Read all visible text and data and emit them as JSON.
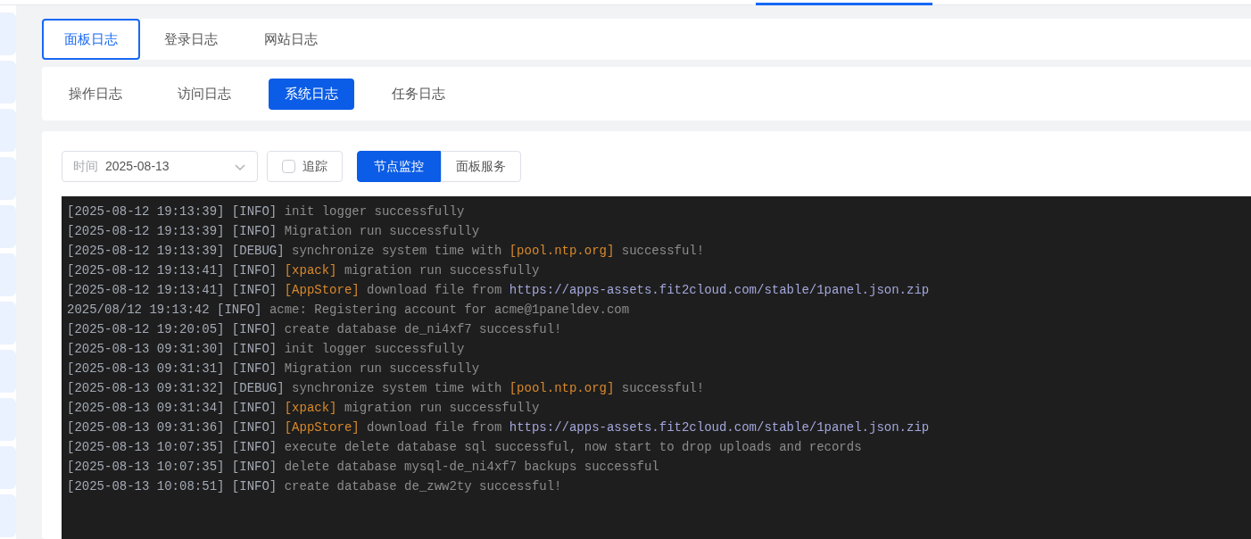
{
  "log_tabs": [
    {
      "label": "面板日志",
      "selected": true
    },
    {
      "label": "登录日志",
      "selected": false
    },
    {
      "label": "网站日志",
      "selected": false
    }
  ],
  "sub_tabs": [
    {
      "label": "操作日志",
      "selected": false
    },
    {
      "label": "访问日志",
      "selected": false
    },
    {
      "label": "系统日志",
      "selected": true
    },
    {
      "label": "任务日志",
      "selected": false
    }
  ],
  "filters": {
    "date_label": "时间",
    "date_value": "2025-08-13",
    "follow": {
      "label": "追踪",
      "checked": false
    }
  },
  "source_buttons": [
    {
      "label": "节点监控",
      "selected": true
    },
    {
      "label": "面板服务",
      "selected": false
    }
  ],
  "log_lines": [
    {
      "segments": [
        {
          "kind": "time",
          "text": "[2025-08-12 19:13:39]"
        },
        {
          "kind": "level",
          "text": "[INFO]"
        },
        {
          "kind": "text",
          "text": "init logger successfully"
        }
      ]
    },
    {
      "segments": [
        {
          "kind": "time",
          "text": "[2025-08-12 19:13:39]"
        },
        {
          "kind": "level",
          "text": "[INFO]"
        },
        {
          "kind": "text",
          "text": "Migration run successfully"
        }
      ]
    },
    {
      "segments": [
        {
          "kind": "time",
          "text": "[2025-08-12 19:13:39]"
        },
        {
          "kind": "level",
          "text": "[DEBUG]"
        },
        {
          "kind": "text",
          "text": "synchronize system time with"
        },
        {
          "kind": "highlight",
          "text": "[pool.ntp.org]"
        },
        {
          "kind": "text",
          "text": "successful!"
        }
      ]
    },
    {
      "segments": [
        {
          "kind": "time",
          "text": "[2025-08-12 19:13:41]"
        },
        {
          "kind": "level",
          "text": "[INFO]"
        },
        {
          "kind": "highlight",
          "text": "[xpack]"
        },
        {
          "kind": "text",
          "text": "migration run successfully"
        }
      ]
    },
    {
      "segments": [
        {
          "kind": "time",
          "text": "[2025-08-12 19:13:41]"
        },
        {
          "kind": "level",
          "text": "[INFO]"
        },
        {
          "kind": "highlight",
          "text": "[AppStore]"
        },
        {
          "kind": "text",
          "text": "download file from"
        },
        {
          "kind": "url",
          "text": "https://apps-assets.fit2cloud.com/stable/1panel.json.zip"
        }
      ]
    },
    {
      "segments": [
        {
          "kind": "time",
          "text": "2025/08/12 19:13:42"
        },
        {
          "kind": "level",
          "text": "[INFO]"
        },
        {
          "kind": "text",
          "text": "acme: Registering account for acme@1paneldev.com"
        }
      ]
    },
    {
      "segments": [
        {
          "kind": "time",
          "text": "[2025-08-12 19:20:05]"
        },
        {
          "kind": "level",
          "text": "[INFO]"
        },
        {
          "kind": "text",
          "text": "create database de_ni4xf7 successful!"
        }
      ]
    },
    {
      "segments": [
        {
          "kind": "time",
          "text": "[2025-08-13 09:31:30]"
        },
        {
          "kind": "level",
          "text": "[INFO]"
        },
        {
          "kind": "text",
          "text": "init logger successfully"
        }
      ]
    },
    {
      "segments": [
        {
          "kind": "time",
          "text": "[2025-08-13 09:31:31]"
        },
        {
          "kind": "level",
          "text": "[INFO]"
        },
        {
          "kind": "text",
          "text": "Migration run successfully"
        }
      ]
    },
    {
      "segments": [
        {
          "kind": "time",
          "text": "[2025-08-13 09:31:32]"
        },
        {
          "kind": "level",
          "text": "[DEBUG]"
        },
        {
          "kind": "text",
          "text": "synchronize system time with"
        },
        {
          "kind": "highlight",
          "text": "[pool.ntp.org]"
        },
        {
          "kind": "text",
          "text": "successful!"
        }
      ]
    },
    {
      "segments": [
        {
          "kind": "time",
          "text": "[2025-08-13 09:31:34]"
        },
        {
          "kind": "level",
          "text": "[INFO]"
        },
        {
          "kind": "highlight",
          "text": "[xpack]"
        },
        {
          "kind": "text",
          "text": "migration run successfully"
        }
      ]
    },
    {
      "segments": [
        {
          "kind": "time",
          "text": "[2025-08-13 09:31:36]"
        },
        {
          "kind": "level",
          "text": "[INFO]"
        },
        {
          "kind": "highlight",
          "text": "[AppStore]"
        },
        {
          "kind": "text",
          "text": "download file from"
        },
        {
          "kind": "url",
          "text": "https://apps-assets.fit2cloud.com/stable/1panel.json.zip"
        }
      ]
    },
    {
      "segments": [
        {
          "kind": "time",
          "text": "[2025-08-13 10:07:35]"
        },
        {
          "kind": "level",
          "text": "[INFO]"
        },
        {
          "kind": "text",
          "text": "execute delete database sql successful, now start to drop uploads and records"
        }
      ]
    },
    {
      "segments": [
        {
          "kind": "time",
          "text": "[2025-08-13 10:07:35]"
        },
        {
          "kind": "level",
          "text": "[INFO]"
        },
        {
          "kind": "text",
          "text": "delete database mysql-de_ni4xf7 backups successful"
        }
      ]
    },
    {
      "segments": [
        {
          "kind": "time",
          "text": "[2025-08-13 10:08:51]"
        },
        {
          "kind": "level",
          "text": "[INFO]"
        },
        {
          "kind": "text",
          "text": "create database de_zww2ty successful!"
        }
      ]
    }
  ]
}
